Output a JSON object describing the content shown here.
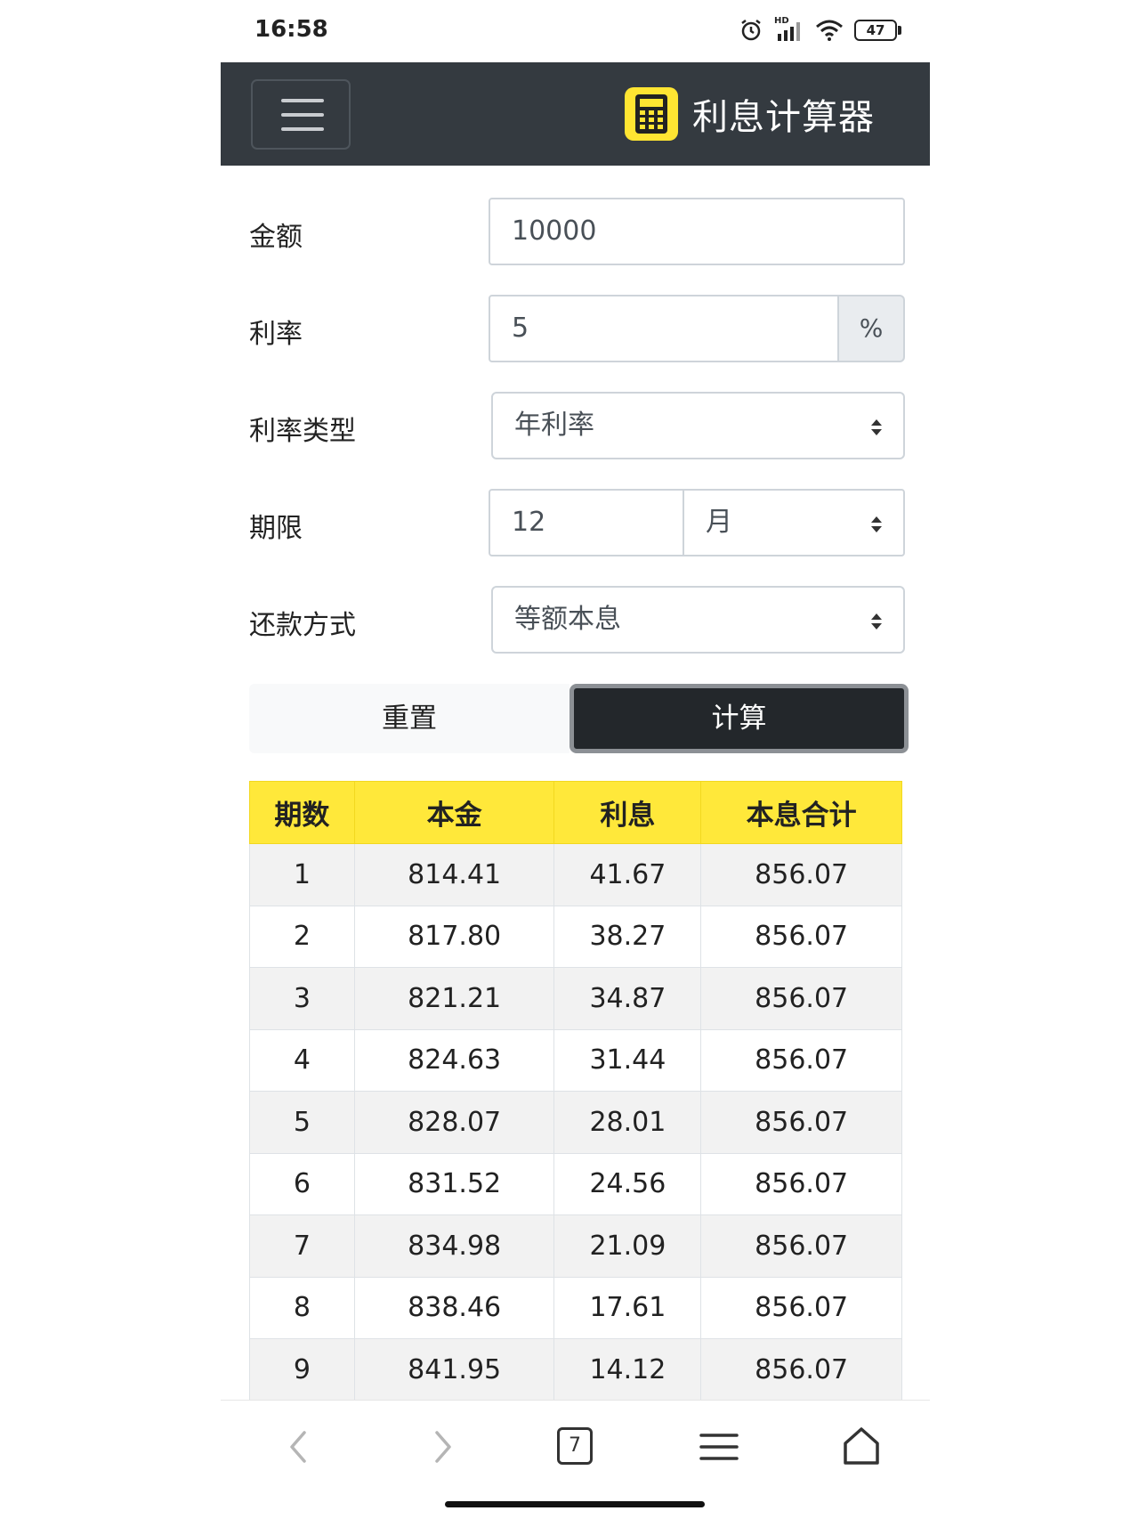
{
  "status_bar": {
    "time": "16:58",
    "network": "HD",
    "battery": "47"
  },
  "header": {
    "title": "利息计算器",
    "brand_icon": "calculator-icon",
    "menu_icon": "hamburger-menu-icon"
  },
  "form": {
    "amount": {
      "label": "金额",
      "value": "10000"
    },
    "rate": {
      "label": "利率",
      "value": "5",
      "unit": "%"
    },
    "rate_type": {
      "label": "利率类型",
      "selected": "年利率"
    },
    "term": {
      "label": "期限",
      "value": "12",
      "unit_selected": "月"
    },
    "repayment": {
      "label": "还款方式",
      "selected": "等额本息"
    }
  },
  "buttons": {
    "reset": "重置",
    "calculate": "计算"
  },
  "table": {
    "headers": [
      "期数",
      "本金",
      "利息",
      "本息合计"
    ],
    "rows": [
      [
        "1",
        "814.41",
        "41.67",
        "856.07"
      ],
      [
        "2",
        "817.80",
        "38.27",
        "856.07"
      ],
      [
        "3",
        "821.21",
        "34.87",
        "856.07"
      ],
      [
        "4",
        "824.63",
        "31.44",
        "856.07"
      ],
      [
        "5",
        "828.07",
        "28.01",
        "856.07"
      ],
      [
        "6",
        "831.52",
        "24.56",
        "856.07"
      ],
      [
        "7",
        "834.98",
        "21.09",
        "856.07"
      ],
      [
        "8",
        "838.46",
        "17.61",
        "856.07"
      ],
      [
        "9",
        "841.95",
        "14.12",
        "856.07"
      ]
    ]
  },
  "bottom_nav": {
    "tab_count": "7"
  },
  "colors": {
    "navbar": "#343a40",
    "accent_yellow": "#ffe83a",
    "calc_button": "#23272b"
  }
}
